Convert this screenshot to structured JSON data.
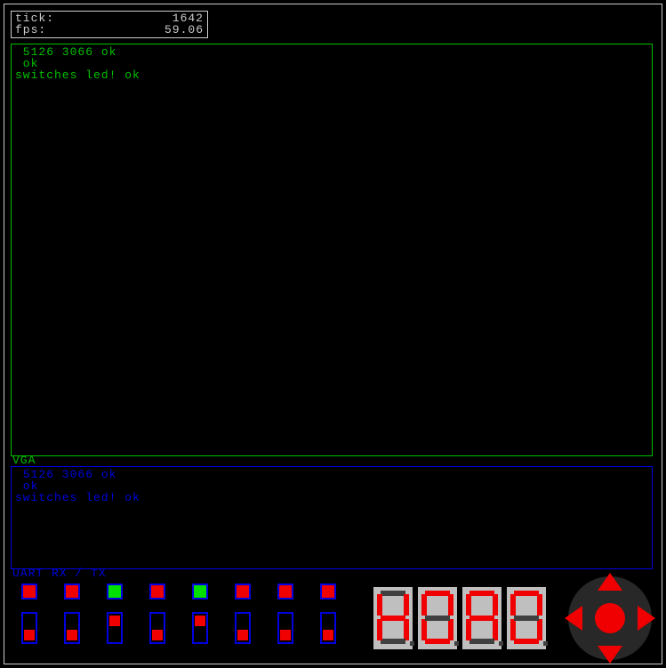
{
  "stats": {
    "tick_label": "tick:",
    "tick_value": "1642",
    "fps_label": "fps:",
    "fps_value": "59.06"
  },
  "vga": {
    "label": "VGA",
    "lines": [
      " 5126 3066 ok",
      " ok",
      "switches led! ok"
    ]
  },
  "uart": {
    "label": "UART RX / TX",
    "lines": [
      " 5126 3066 ok",
      " ok",
      "switches led! ok"
    ]
  },
  "leds": [
    false,
    false,
    true,
    false,
    true,
    false,
    false,
    false
  ],
  "switches": [
    "down",
    "down",
    "up",
    "down",
    "up",
    "down",
    "down",
    "down"
  ],
  "seven_seg": [
    [
      "b",
      "c",
      "e",
      "f",
      "g"
    ],
    [
      "a",
      "b",
      "c",
      "d",
      "e",
      "f"
    ],
    [
      "a",
      "b",
      "c",
      "e",
      "f",
      "g"
    ],
    [
      "a",
      "b",
      "c",
      "d",
      "e",
      "f"
    ]
  ],
  "dpad": {
    "up": true,
    "down": true,
    "left": true,
    "right": true,
    "center": true
  }
}
